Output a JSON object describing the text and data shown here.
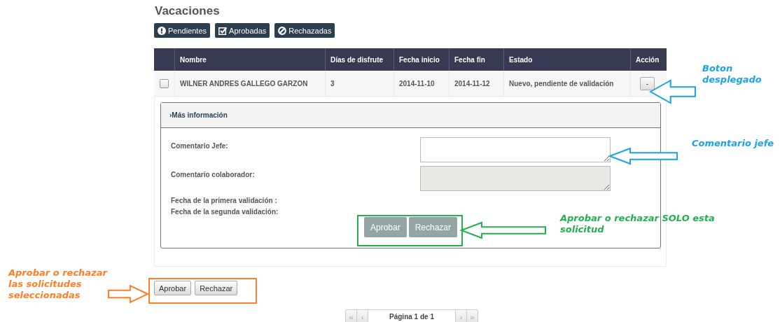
{
  "title": "Vacaciones",
  "filters": [
    {
      "label": "Pendientes",
      "kind": "pending"
    },
    {
      "label": "Aprobadas",
      "kind": "approved"
    },
    {
      "label": "Rechazadas",
      "kind": "rejected"
    }
  ],
  "table": {
    "columns": [
      "Nombre",
      "Días de disfrute",
      "Fecha inicio",
      "Fecha fin",
      "Estado",
      "Acción"
    ],
    "rows": [
      {
        "checked": false,
        "expanded": true,
        "toggle": "-",
        "cells": [
          "WILNER ANDRES GALLEGO GARZON",
          "3",
          "2014-11-10",
          "2014-11-12",
          "Nuevo, pendiente de validación"
        ]
      }
    ]
  },
  "detail": {
    "header": "Más información",
    "header_icon": "›",
    "fields": [
      {
        "label": "Comentario Jefe:",
        "disabled": false
      },
      {
        "label": "Comentario colaborador:",
        "disabled": true
      }
    ],
    "dates": [
      "Fecha de la primera validación :",
      "Fecha de la segunda validación:"
    ],
    "buttons": [
      "Aprobar",
      "Rechazar"
    ]
  },
  "bulk_buttons": [
    "Aprobar",
    "Rechazar"
  ],
  "pagination": {
    "first": {
      "label": "«",
      "disabled": true
    },
    "prev": {
      "label": "‹",
      "disabled": true
    },
    "page": "Página 1 de 1",
    "next": {
      "label": "›",
      "disabled": true
    },
    "last": {
      "label": "»",
      "disabled": true
    }
  },
  "annotations": [
    {
      "text": "Boton desplegado",
      "color": "#1aa3e8"
    },
    {
      "text": "Comentario jefe",
      "color": "#1aa3e8"
    },
    {
      "text": "Aprobar o rechazar SOLO esta solicitud",
      "color": "#22b14c"
    },
    {
      "text": "Aprobar o rechazar las solicitudes seleccionadas",
      "color": "#ff7f27"
    }
  ]
}
